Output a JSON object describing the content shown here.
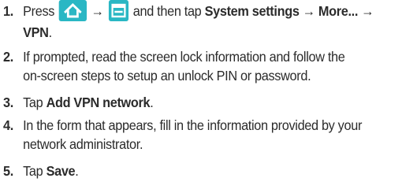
{
  "steps": [
    {
      "number": "1.",
      "parts": {
        "press": "Press",
        "arrow1": "→",
        "then": "and then tap",
        "system": "System settings",
        "arrow2": "→",
        "more": "More...",
        "arrow3": "→",
        "vpn": "VPN",
        "end": "."
      },
      "icons": [
        "home-key-icon",
        "menu-key-icon"
      ]
    },
    {
      "number": "2.",
      "line1": "If prompted, read the screen lock information and follow the",
      "line2": "on-screen steps to setup an unlock PIN or password."
    },
    {
      "number": "3.",
      "pre": "Tap",
      "bold": "Add VPN network",
      "end": "."
    },
    {
      "number": "4.",
      "line1": "In the form that appears, fill in the information provided by your",
      "line2": "network administrator."
    },
    {
      "number": "5.",
      "pre": "Tap",
      "bold": "Save",
      "end": "."
    }
  ],
  "colors": {
    "key_background": "#2ab7c4",
    "text": "#2b2b2b"
  }
}
